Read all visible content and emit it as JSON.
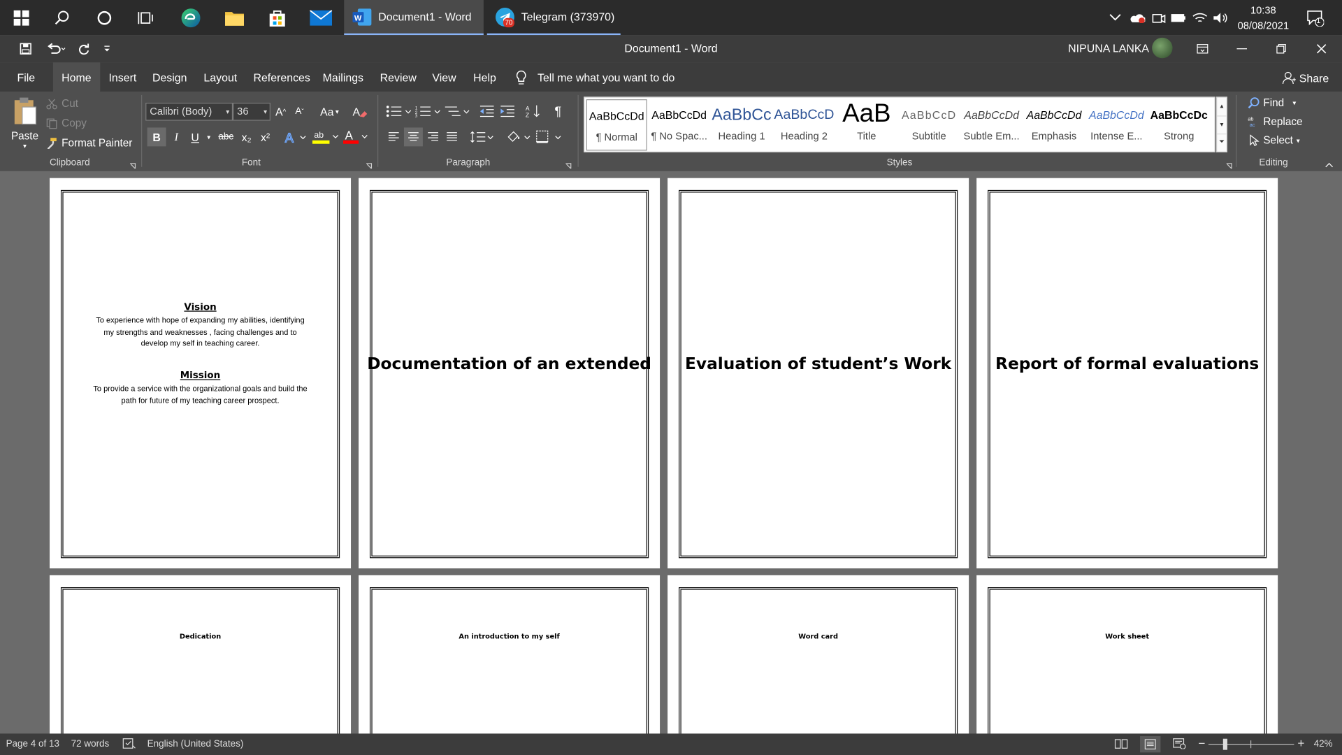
{
  "taskbar": {
    "apps": [
      {
        "label": "Document1 - Word",
        "icon": "word-icon"
      },
      {
        "label": "Telegram (373970)",
        "icon": "telegram-icon",
        "badge": "70"
      }
    ],
    "clock": {
      "time": "10:38",
      "date": "08/08/2021"
    },
    "notifications": "1"
  },
  "window": {
    "title": "Document1  -  Word",
    "user": "NIPUNA LANKA"
  },
  "ribbon_tabs": [
    "File",
    "Home",
    "Insert",
    "Design",
    "Layout",
    "References",
    "Mailings",
    "Review",
    "View",
    "Help"
  ],
  "active_tab": "Home",
  "tell_me": "Tell me what you want to do",
  "share": "Share",
  "clipboard": {
    "paste": "Paste",
    "cut": "Cut",
    "copy": "Copy",
    "format_painter": "Format Painter",
    "label": "Clipboard"
  },
  "font": {
    "name": "Calibri (Body)",
    "size": "36",
    "label": "Font",
    "bold": "B",
    "italic": "I",
    "underline": "U",
    "strike": "abc",
    "sub": "x₂",
    "sup": "x²",
    "grow": "A^",
    "shrink": "Aˇ",
    "case": "Aa"
  },
  "paragraph": {
    "label": "Paragraph"
  },
  "styles": {
    "label": "Styles",
    "items": [
      {
        "preview": "AaBbCcDd",
        "name": "¶ Normal"
      },
      {
        "preview": "AaBbCcDd",
        "name": "¶ No Spac..."
      },
      {
        "preview": "AaBbCc",
        "name": "Heading 1"
      },
      {
        "preview": "AaBbCcD",
        "name": "Heading 2"
      },
      {
        "preview": "AaB",
        "name": "Title"
      },
      {
        "preview": "AaBbCcD",
        "name": "Subtitle"
      },
      {
        "preview": "AaBbCcDd",
        "name": "Subtle Em..."
      },
      {
        "preview": "AaBbCcDd",
        "name": "Emphasis"
      },
      {
        "preview": "AaBbCcDd",
        "name": "Intense E..."
      },
      {
        "preview": "AaBbCcDc",
        "name": "Strong"
      }
    ]
  },
  "editing": {
    "label": "Editing",
    "find": "Find",
    "replace": "Replace",
    "select": "Select"
  },
  "pages": {
    "p1": {
      "vision_heading": "Vision",
      "vision_text": [
        "To experience with hope of expanding my abilities, identifying",
        "my strengths and weaknesses , facing challenges and to",
        "develop my self in teaching career."
      ],
      "mission_heading": "Mission",
      "mission_text": [
        "To provide a service with the organizational goals and build the",
        "path for future of my teaching career prospect."
      ]
    },
    "p2": "Documentation of an extended",
    "p3": "Evaluation of student’s Work",
    "p4": "Report of formal evaluations",
    "p5": "Dedication",
    "p6": "An introduction to my self",
    "p7": "Word card",
    "p8": "Work sheet"
  },
  "status": {
    "page": "Page 4 of 13",
    "words": "72 words",
    "language": "English (United States)",
    "zoom": "42%"
  },
  "colors": {
    "accent_word": "#2b579a",
    "telegram": "#2aa3df",
    "highlight": "#ffff00",
    "font_color": "#ff0000"
  }
}
